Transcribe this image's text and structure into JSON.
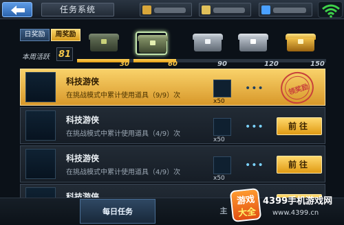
{
  "topbar": {
    "title": "任务系统",
    "icons": [
      "back-arrow-icon",
      "wifi-signal-icon"
    ],
    "resources": [
      {
        "icon": "gold-coin-icon",
        "color": "#d8a63a"
      },
      {
        "icon": "gem-icon",
        "color": "#e0c05a"
      },
      {
        "icon": "ticket-icon",
        "color": "#4aa0ff"
      }
    ]
  },
  "tabs": {
    "daily_reward": "日奖励",
    "weekly_reward": "周奖励"
  },
  "activity": {
    "label": "本周活跃",
    "value": "81"
  },
  "milestones": [
    {
      "value": "30",
      "reached": true
    },
    {
      "value": "60",
      "reached": true
    },
    {
      "value": "90",
      "reached": false
    },
    {
      "value": "120",
      "reached": false
    },
    {
      "value": "150",
      "reached": false
    }
  ],
  "tasks": [
    {
      "title": "科技游侠",
      "desc": "在挑战模式中累计使用道具（9/9）次",
      "reward_count": "x50",
      "state": "claimed",
      "stamp": "领奖励"
    },
    {
      "title": "科技游侠",
      "desc": "在挑战模式中累计使用道具（4/9）次",
      "reward_count": "x50",
      "state": "go",
      "button": "前往"
    },
    {
      "title": "科技游侠",
      "desc": "在挑战模式中累计使用道具（4/9）次",
      "reward_count": "x50",
      "state": "go",
      "button": "前往"
    },
    {
      "title": "科技游侠",
      "desc": "",
      "reward_count": "",
      "state": "go",
      "button": ""
    }
  ],
  "bottom_tabs": {
    "daily_tasks": "每日任务",
    "main_partial": "主"
  },
  "watermark": {
    "logo_line1": "游戏",
    "logo_line2": "大全",
    "site": "4399手机游戏网",
    "url": "www.4399.cn"
  },
  "colors": {
    "accent_gold": "#e5a21b",
    "accent_blue": "#4f8ad6",
    "stamp_red": "#c8413a"
  }
}
